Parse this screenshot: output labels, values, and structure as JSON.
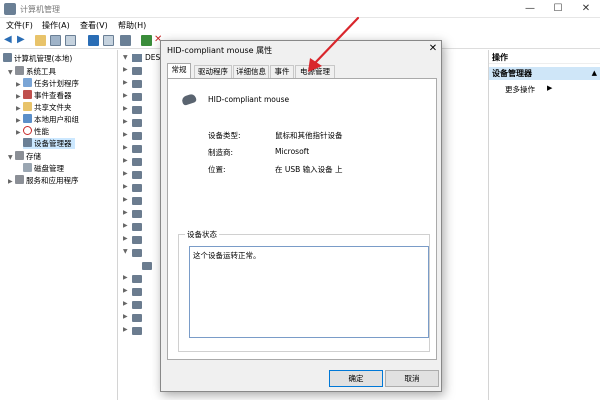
{
  "window": {
    "title": "计算机管理",
    "controls": {
      "minimize": "—",
      "maximize": "☐",
      "close": "✕"
    }
  },
  "menu": [
    "文件(F)",
    "操作(A)",
    "查看(V)",
    "帮助(H)"
  ],
  "tree": {
    "root": "计算机管理(本地)",
    "items": [
      {
        "label": "系统工具",
        "level": 1,
        "expanded": true
      },
      {
        "label": "任务计划程序",
        "level": 2
      },
      {
        "label": "事件查看器",
        "level": 2
      },
      {
        "label": "共享文件夹",
        "level": 2
      },
      {
        "label": "本地用户和组",
        "level": 2
      },
      {
        "label": "性能",
        "level": 2
      },
      {
        "label": "设备管理器",
        "level": 2,
        "selected": true
      },
      {
        "label": "存储",
        "level": 1,
        "expanded": true
      },
      {
        "label": "磁盘管理",
        "level": 2
      },
      {
        "label": "服务和应用程序",
        "level": 1
      }
    ]
  },
  "devlist": {
    "root_label": "DES"
  },
  "actions": {
    "header": "操作",
    "selected": "设备管理器",
    "more": "更多操作"
  },
  "dialog": {
    "title": "HID-compliant mouse 属性",
    "close": "✕",
    "tabs": [
      "常规",
      "驱动程序",
      "详细信息",
      "事件",
      "电源管理"
    ],
    "device_name": "HID-compliant mouse",
    "properties": [
      {
        "label": "设备类型:",
        "value": "鼠标和其他指针设备"
      },
      {
        "label": "制造商:",
        "value": "Microsoft"
      },
      {
        "label": "位置:",
        "value": "在 USB 输入设备 上"
      }
    ],
    "status_label": "设备状态",
    "status_text": "这个设备运转正常。",
    "ok": "确定",
    "cancel": "取消"
  },
  "colors": {
    "arrow": "#d9262c",
    "selection": "#cce8ff",
    "accent": "#0078d7"
  }
}
